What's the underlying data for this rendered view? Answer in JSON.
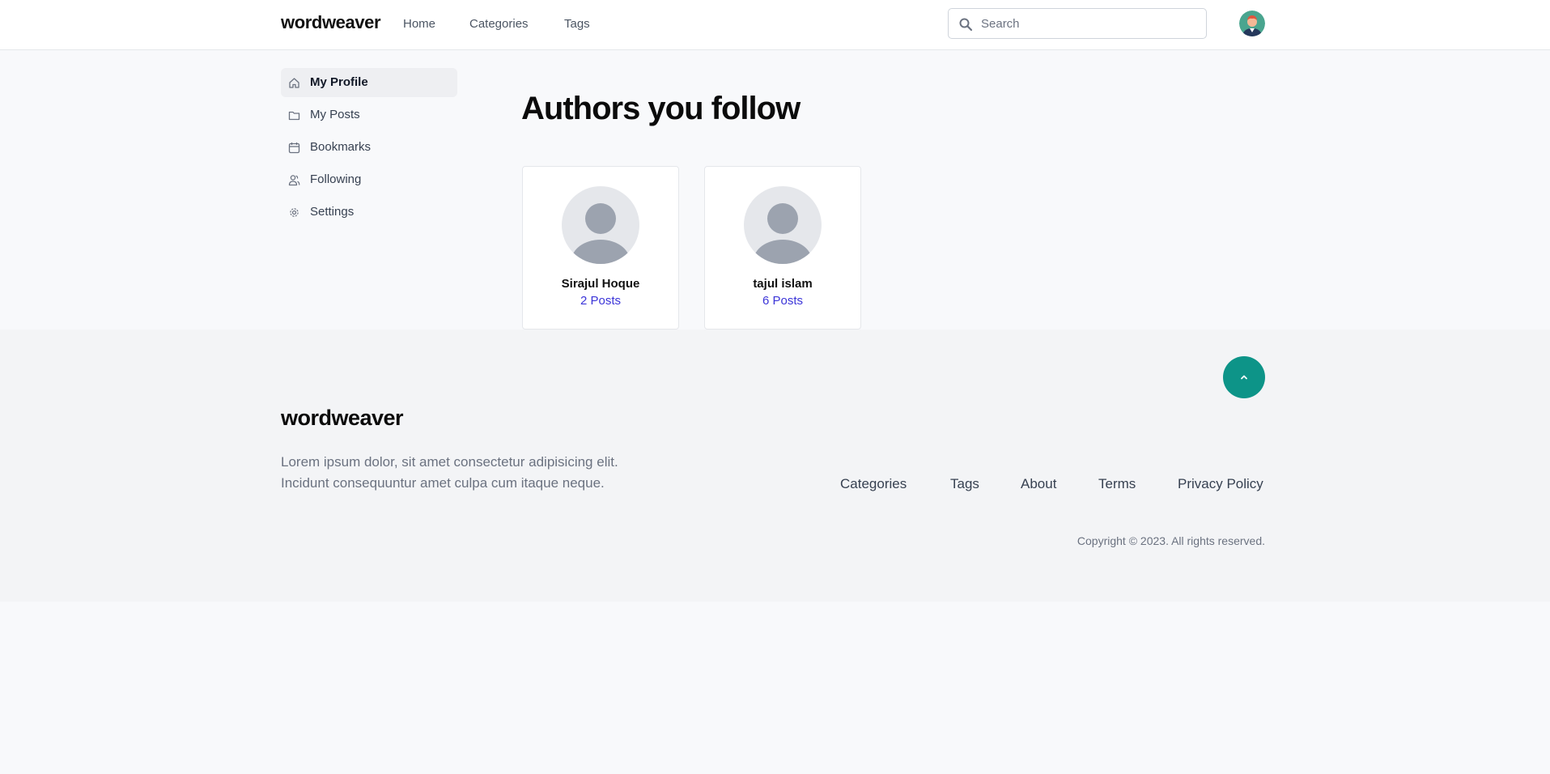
{
  "header": {
    "logo": "wordweaver",
    "nav": [
      "Home",
      "Categories",
      "Tags"
    ],
    "search_placeholder": "Search",
    "search_value": ""
  },
  "sidebar": {
    "items": [
      {
        "label": "My Profile",
        "icon": "home-icon",
        "active": true
      },
      {
        "label": "My Posts",
        "icon": "folder-icon",
        "active": false
      },
      {
        "label": "Bookmarks",
        "icon": "calendar-icon",
        "active": false
      },
      {
        "label": "Following",
        "icon": "users-icon",
        "active": false
      },
      {
        "label": "Settings",
        "icon": "gear-icon",
        "active": false
      }
    ]
  },
  "main": {
    "title": "Authors you follow",
    "authors": [
      {
        "name": "Sirajul Hoque",
        "posts": "2 Posts"
      },
      {
        "name": "tajul islam",
        "posts": "6 Posts"
      }
    ]
  },
  "footer": {
    "logo": "wordweaver",
    "description": "Lorem ipsum dolor, sit amet consectetur adipisicing elit. Incidunt consequuntur amet culpa cum itaque neque.",
    "links": [
      "Categories",
      "Tags",
      "About",
      "Terms",
      "Privacy Policy"
    ],
    "copyright": "Copyright © 2023. All rights reserved."
  },
  "colors": {
    "accent_teal": "#0d9488",
    "post_count_blue": "#3b34d8",
    "page_bg": "#f8f9fb",
    "footer_bg": "#f3f4f6"
  }
}
